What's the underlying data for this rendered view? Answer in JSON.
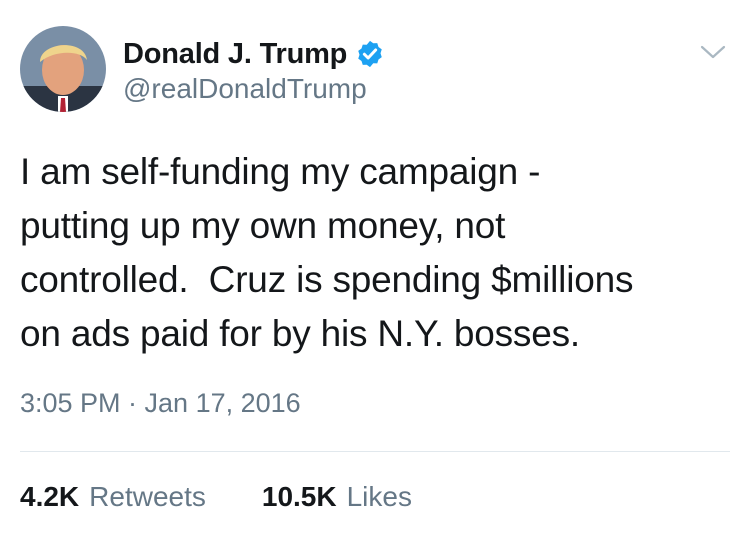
{
  "user": {
    "display_name": "Donald J. Trump",
    "handle": "@realDonaldTrump",
    "verified": true
  },
  "tweet": {
    "text": "I am self-funding my campaign -\nputting up my own money, not\ncontrolled.  Cruz is spending $millions\non ads paid for by his N.Y. bosses.",
    "timestamp": "3:05 PM · Jan 17, 2016"
  },
  "stats": {
    "retweets_count": "4.2K",
    "retweets_label": "Retweets",
    "likes_count": "10.5K",
    "likes_label": "Likes"
  },
  "icons": {
    "verified": "verified-badge-icon",
    "menu": "chevron-down-icon"
  },
  "colors": {
    "text": "#14171a",
    "secondary": "#657786",
    "verified_blue": "#1da1f2",
    "divider": "#e1e8ed"
  }
}
